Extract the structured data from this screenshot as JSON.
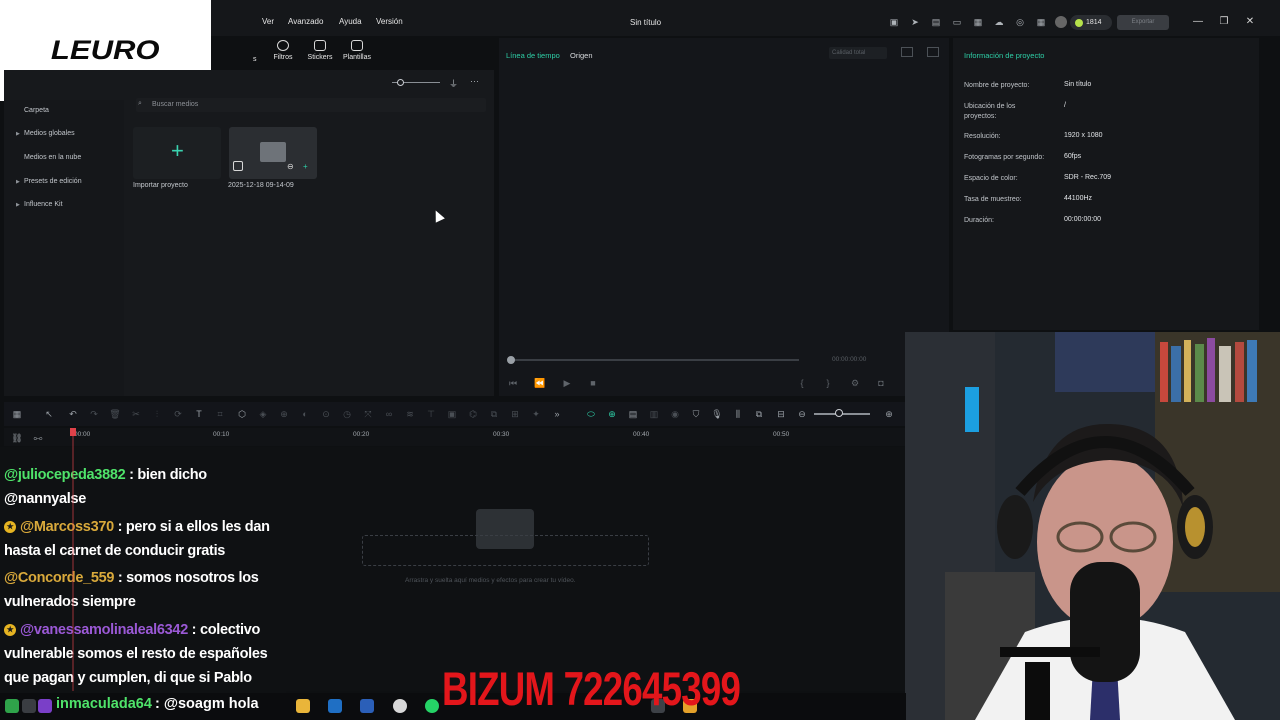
{
  "window": {
    "title": "Sin título"
  },
  "logo": {
    "text": "LEURO"
  },
  "menu": [
    "Ver",
    "Avanzado",
    "Ayuda",
    "Versión"
  ],
  "credits": "1814",
  "media_tabs": [
    "Filtros",
    "Stickers",
    "Plantillas"
  ],
  "media_tab_partial": "s",
  "sidebar": {
    "items": [
      "Carpeta",
      "Medios globales",
      "Medios en la nube",
      "Presets de edición",
      "Influence Kit"
    ]
  },
  "search": {
    "placeholder": "Buscar medios"
  },
  "media": {
    "import_label": "Importar proyecto",
    "clip_label": "2025-12-18 09-14-09"
  },
  "preview": {
    "tabs": [
      "Línea de tiempo",
      "Origen"
    ],
    "quality": "Calidad total",
    "time": "00:00:00:00"
  },
  "project_info": {
    "title": "Información de proyecto",
    "rows": [
      {
        "key": "Nombre de proyecto:",
        "value": "Sin título"
      },
      {
        "key": "Ubicación de los proyectos:",
        "value": "/"
      },
      {
        "key": "Resolución:",
        "value": "1920 x 1080"
      },
      {
        "key": "Fotogramas por segundo:",
        "value": "60fps"
      },
      {
        "key": "Espacio de color:",
        "value": "SDR - Rec.709"
      },
      {
        "key": "Tasa de muestreo:",
        "value": "44100Hz"
      },
      {
        "key": "Duración:",
        "value": "00:00:00:00"
      }
    ]
  },
  "timeline": {
    "ruler": [
      "00:00",
      "00:10",
      "00:20",
      "00:30",
      "00:40",
      "00:50"
    ],
    "drop_hint": "Arrastra y suelta aquí medios y efectos para crear tu vídeo."
  },
  "chat": {
    "messages": [
      {
        "user": "@juliocepeda3882",
        "text": " : bien dicho @nannyalse",
        "user_color": "#4fe36a",
        "badge": false
      },
      {
        "user": "@Marcoss370",
        "text": " : pero si a ellos les dan hasta el carnet de conducir gratis",
        "user_color": "#d9a93b",
        "badge": true
      },
      {
        "user": "@Concorde_559",
        "text": " : somos nosotros los vulnerados siempre",
        "user_color": "#d9a93b",
        "badge": false
      },
      {
        "user": "@vanessamolinaleal6342",
        "text": " : colectivo vulnerable somos el resto de españoles que pagan y cumplen, di que si Pablo",
        "user_color": "#9b59d6",
        "badge": true
      },
      {
        "user": "inmaculada64",
        "text": " : @soagm hola",
        "user_color": "#4fe36a",
        "badge": false
      }
    ]
  },
  "overlay": {
    "bizum": "BIZUM 722645399"
  },
  "colors": {
    "accent": "#2ecfa7",
    "bizum": "#e3161b",
    "playhead": "#e0424a"
  }
}
